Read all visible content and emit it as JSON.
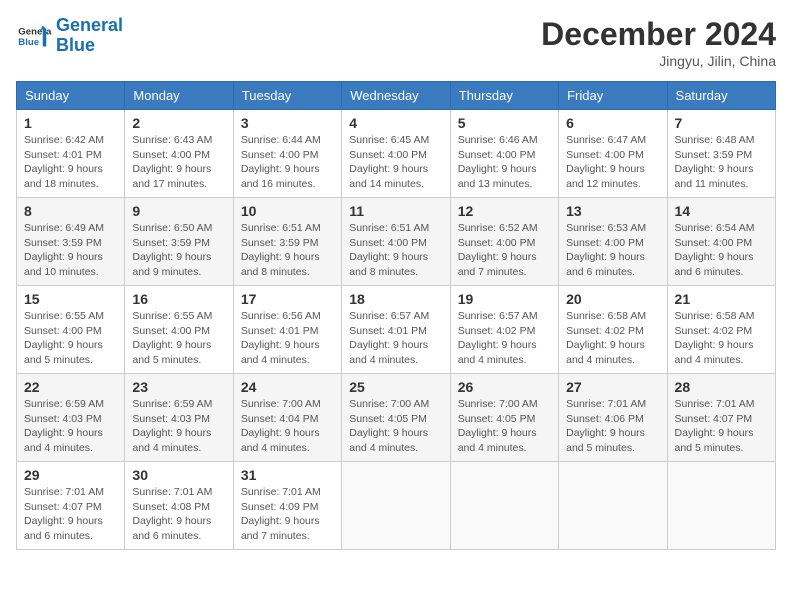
{
  "header": {
    "logo_line1": "General",
    "logo_line2": "Blue",
    "month": "December 2024",
    "location": "Jingyu, Jilin, China"
  },
  "weekdays": [
    "Sunday",
    "Monday",
    "Tuesday",
    "Wednesday",
    "Thursday",
    "Friday",
    "Saturday"
  ],
  "weeks": [
    [
      {
        "day": "1",
        "info": "Sunrise: 6:42 AM\nSunset: 4:01 PM\nDaylight: 9 hours\nand 18 minutes."
      },
      {
        "day": "2",
        "info": "Sunrise: 6:43 AM\nSunset: 4:00 PM\nDaylight: 9 hours\nand 17 minutes."
      },
      {
        "day": "3",
        "info": "Sunrise: 6:44 AM\nSunset: 4:00 PM\nDaylight: 9 hours\nand 16 minutes."
      },
      {
        "day": "4",
        "info": "Sunrise: 6:45 AM\nSunset: 4:00 PM\nDaylight: 9 hours\nand 14 minutes."
      },
      {
        "day": "5",
        "info": "Sunrise: 6:46 AM\nSunset: 4:00 PM\nDaylight: 9 hours\nand 13 minutes."
      },
      {
        "day": "6",
        "info": "Sunrise: 6:47 AM\nSunset: 4:00 PM\nDaylight: 9 hours\nand 12 minutes."
      },
      {
        "day": "7",
        "info": "Sunrise: 6:48 AM\nSunset: 3:59 PM\nDaylight: 9 hours\nand 11 minutes."
      }
    ],
    [
      {
        "day": "8",
        "info": "Sunrise: 6:49 AM\nSunset: 3:59 PM\nDaylight: 9 hours\nand 10 minutes."
      },
      {
        "day": "9",
        "info": "Sunrise: 6:50 AM\nSunset: 3:59 PM\nDaylight: 9 hours\nand 9 minutes."
      },
      {
        "day": "10",
        "info": "Sunrise: 6:51 AM\nSunset: 3:59 PM\nDaylight: 9 hours\nand 8 minutes."
      },
      {
        "day": "11",
        "info": "Sunrise: 6:51 AM\nSunset: 4:00 PM\nDaylight: 9 hours\nand 8 minutes."
      },
      {
        "day": "12",
        "info": "Sunrise: 6:52 AM\nSunset: 4:00 PM\nDaylight: 9 hours\nand 7 minutes."
      },
      {
        "day": "13",
        "info": "Sunrise: 6:53 AM\nSunset: 4:00 PM\nDaylight: 9 hours\nand 6 minutes."
      },
      {
        "day": "14",
        "info": "Sunrise: 6:54 AM\nSunset: 4:00 PM\nDaylight: 9 hours\nand 6 minutes."
      }
    ],
    [
      {
        "day": "15",
        "info": "Sunrise: 6:55 AM\nSunset: 4:00 PM\nDaylight: 9 hours\nand 5 minutes."
      },
      {
        "day": "16",
        "info": "Sunrise: 6:55 AM\nSunset: 4:00 PM\nDaylight: 9 hours\nand 5 minutes."
      },
      {
        "day": "17",
        "info": "Sunrise: 6:56 AM\nSunset: 4:01 PM\nDaylight: 9 hours\nand 4 minutes."
      },
      {
        "day": "18",
        "info": "Sunrise: 6:57 AM\nSunset: 4:01 PM\nDaylight: 9 hours\nand 4 minutes."
      },
      {
        "day": "19",
        "info": "Sunrise: 6:57 AM\nSunset: 4:02 PM\nDaylight: 9 hours\nand 4 minutes."
      },
      {
        "day": "20",
        "info": "Sunrise: 6:58 AM\nSunset: 4:02 PM\nDaylight: 9 hours\nand 4 minutes."
      },
      {
        "day": "21",
        "info": "Sunrise: 6:58 AM\nSunset: 4:02 PM\nDaylight: 9 hours\nand 4 minutes."
      }
    ],
    [
      {
        "day": "22",
        "info": "Sunrise: 6:59 AM\nSunset: 4:03 PM\nDaylight: 9 hours\nand 4 minutes."
      },
      {
        "day": "23",
        "info": "Sunrise: 6:59 AM\nSunset: 4:03 PM\nDaylight: 9 hours\nand 4 minutes."
      },
      {
        "day": "24",
        "info": "Sunrise: 7:00 AM\nSunset: 4:04 PM\nDaylight: 9 hours\nand 4 minutes."
      },
      {
        "day": "25",
        "info": "Sunrise: 7:00 AM\nSunset: 4:05 PM\nDaylight: 9 hours\nand 4 minutes."
      },
      {
        "day": "26",
        "info": "Sunrise: 7:00 AM\nSunset: 4:05 PM\nDaylight: 9 hours\nand 4 minutes."
      },
      {
        "day": "27",
        "info": "Sunrise: 7:01 AM\nSunset: 4:06 PM\nDaylight: 9 hours\nand 5 minutes."
      },
      {
        "day": "28",
        "info": "Sunrise: 7:01 AM\nSunset: 4:07 PM\nDaylight: 9 hours\nand 5 minutes."
      }
    ],
    [
      {
        "day": "29",
        "info": "Sunrise: 7:01 AM\nSunset: 4:07 PM\nDaylight: 9 hours\nand 6 minutes."
      },
      {
        "day": "30",
        "info": "Sunrise: 7:01 AM\nSunset: 4:08 PM\nDaylight: 9 hours\nand 6 minutes."
      },
      {
        "day": "31",
        "info": "Sunrise: 7:01 AM\nSunset: 4:09 PM\nDaylight: 9 hours\nand 7 minutes."
      },
      null,
      null,
      null,
      null
    ]
  ]
}
